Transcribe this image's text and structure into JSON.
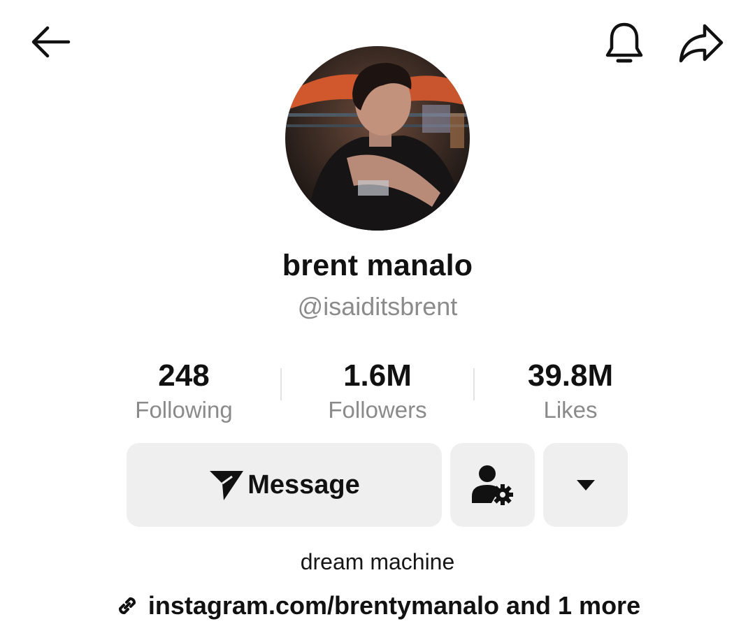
{
  "header": {
    "back_icon": "arrow-left-icon",
    "bell_icon": "bell-icon",
    "share_icon": "share-arrow-icon"
  },
  "profile": {
    "display_name": "brent manalo",
    "username": "@isaiditsbrent",
    "avatar_alt": "profile photo"
  },
  "stats": [
    {
      "value": "248",
      "label": "Following"
    },
    {
      "value": "1.6M",
      "label": "Followers"
    },
    {
      "value": "39.8M",
      "label": "Likes"
    }
  ],
  "actions": {
    "message_label": "Message",
    "message_icon": "paper-plane-icon",
    "friends_icon": "person-gear-icon",
    "more_icon": "caret-down-icon"
  },
  "bio": {
    "text": "dream machine",
    "link_icon": "link-icon",
    "link_text": "instagram.com/brentymanalo and 1 more"
  }
}
